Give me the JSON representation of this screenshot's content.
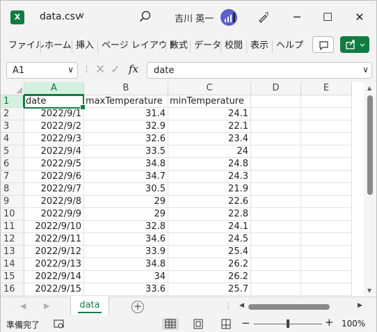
{
  "window": {
    "title": "data.csv",
    "title_caret": "∨",
    "user_name": "吉川 英一",
    "buttons": {
      "minimize": "─",
      "maximize": "☐",
      "close": "✕"
    }
  },
  "ribbon": {
    "tabs": [
      "ファイル",
      "ホーム",
      "挿入",
      "ページ レイアウト",
      "数式",
      "データ",
      "校閲",
      "表示",
      "ヘルプ"
    ]
  },
  "formula_bar": {
    "name_box": "A1",
    "formula": "date",
    "fx_label": "fx",
    "cancel_icon": "✕",
    "enter_icon": "✓"
  },
  "columns": [
    "A",
    "B",
    "C",
    "D",
    "E"
  ],
  "rows": [
    [
      "date",
      "maxTemperature",
      "minTemperature"
    ],
    [
      "2022/9/1",
      "31.4",
      "24.1"
    ],
    [
      "2022/9/2",
      "32.9",
      "22.1"
    ],
    [
      "2022/9/3",
      "32.6",
      "23.4"
    ],
    [
      "2022/9/4",
      "33.5",
      "24"
    ],
    [
      "2022/9/5",
      "34.8",
      "24.8"
    ],
    [
      "2022/9/6",
      "34.7",
      "24.3"
    ],
    [
      "2022/9/7",
      "30.5",
      "21.9"
    ],
    [
      "2022/9/8",
      "29",
      "22.6"
    ],
    [
      "2022/9/9",
      "29",
      "22.8"
    ],
    [
      "2022/9/10",
      "32.8",
      "24.1"
    ],
    [
      "2022/9/11",
      "34.6",
      "24.5"
    ],
    [
      "2022/9/12",
      "33.9",
      "25.4"
    ],
    [
      "2022/9/13",
      "34.8",
      "26.2"
    ],
    [
      "2022/9/14",
      "34",
      "26.2"
    ],
    [
      "2022/9/15",
      "33.6",
      "25.7"
    ]
  ],
  "sheets": {
    "active": "data",
    "add": "+"
  },
  "status": {
    "ready": "準備完了",
    "zoom_minus": "−",
    "zoom_plus": "+",
    "zoom_level": "100%",
    "zoom_fraction": 0.5
  },
  "colors": {
    "accent": "#107c41",
    "selected_header": "#d3f0e0"
  }
}
